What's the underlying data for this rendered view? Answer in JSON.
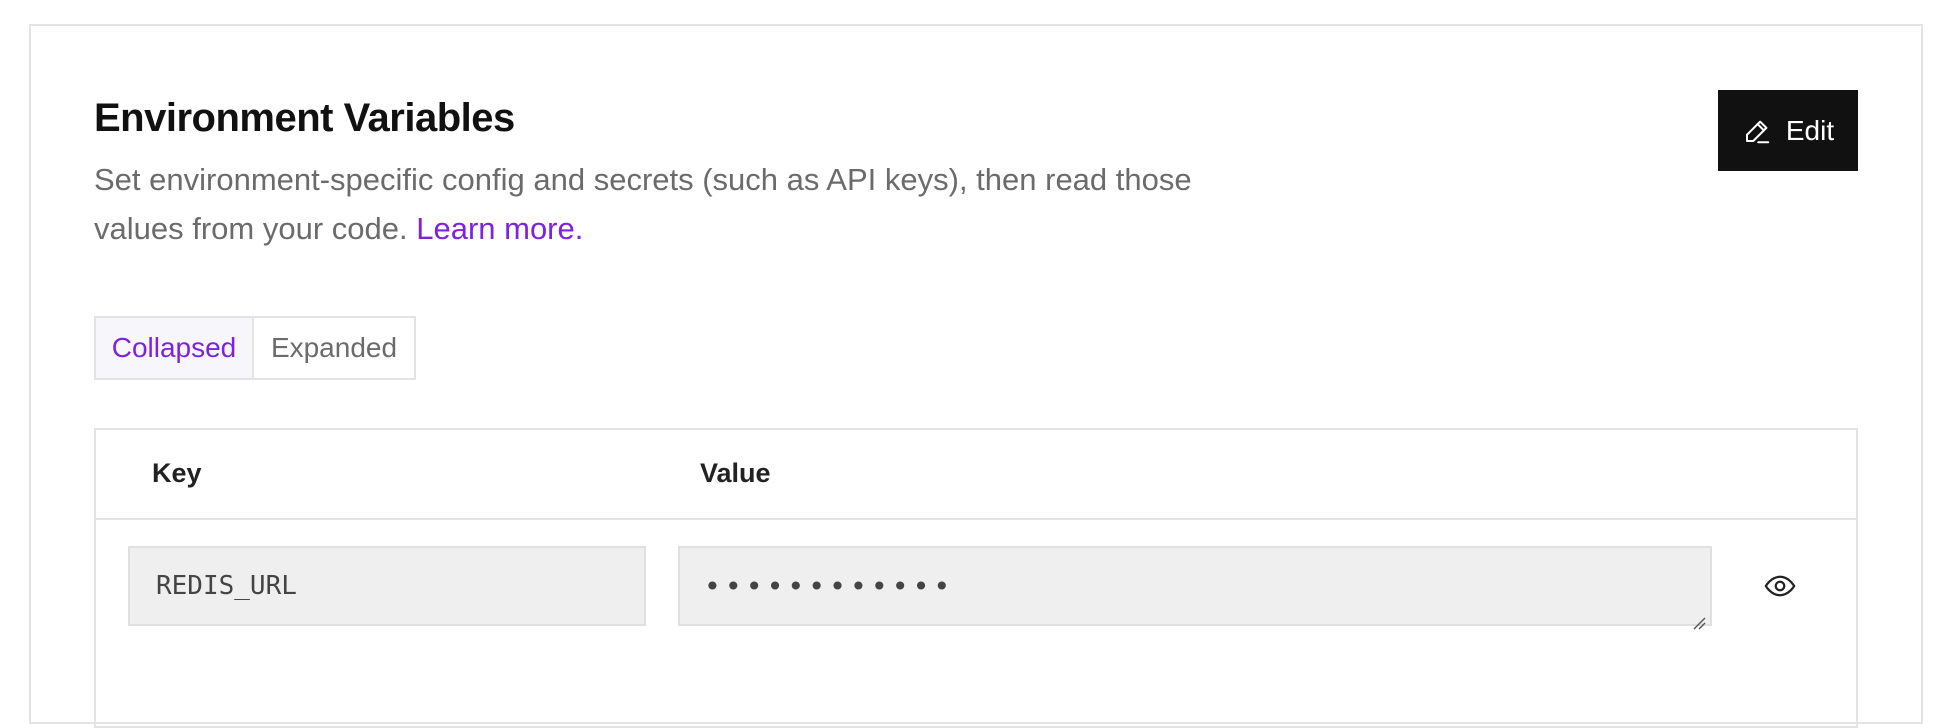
{
  "section": {
    "title": "Environment Variables",
    "description": "Set environment-specific config and secrets (such as API keys), then read those values from your code.",
    "learn_more_label": "Learn more."
  },
  "toolbar": {
    "edit_label": "Edit",
    "edit_icon": "pencil-icon"
  },
  "view_toggle": {
    "options": [
      "Collapsed",
      "Expanded"
    ],
    "selected": "Collapsed"
  },
  "env_table": {
    "columns": [
      "Key",
      "Value"
    ],
    "rows": [
      {
        "key": "REDIS_URL",
        "value_masked": "••••••••••••",
        "reveal_icon": "eye-icon"
      }
    ]
  },
  "colors": {
    "accent": "#7e22e0",
    "button_bg": "#111111",
    "border": "#e3e3e3",
    "field_bg": "#efefef",
    "muted_text": "#6b6b6b"
  }
}
